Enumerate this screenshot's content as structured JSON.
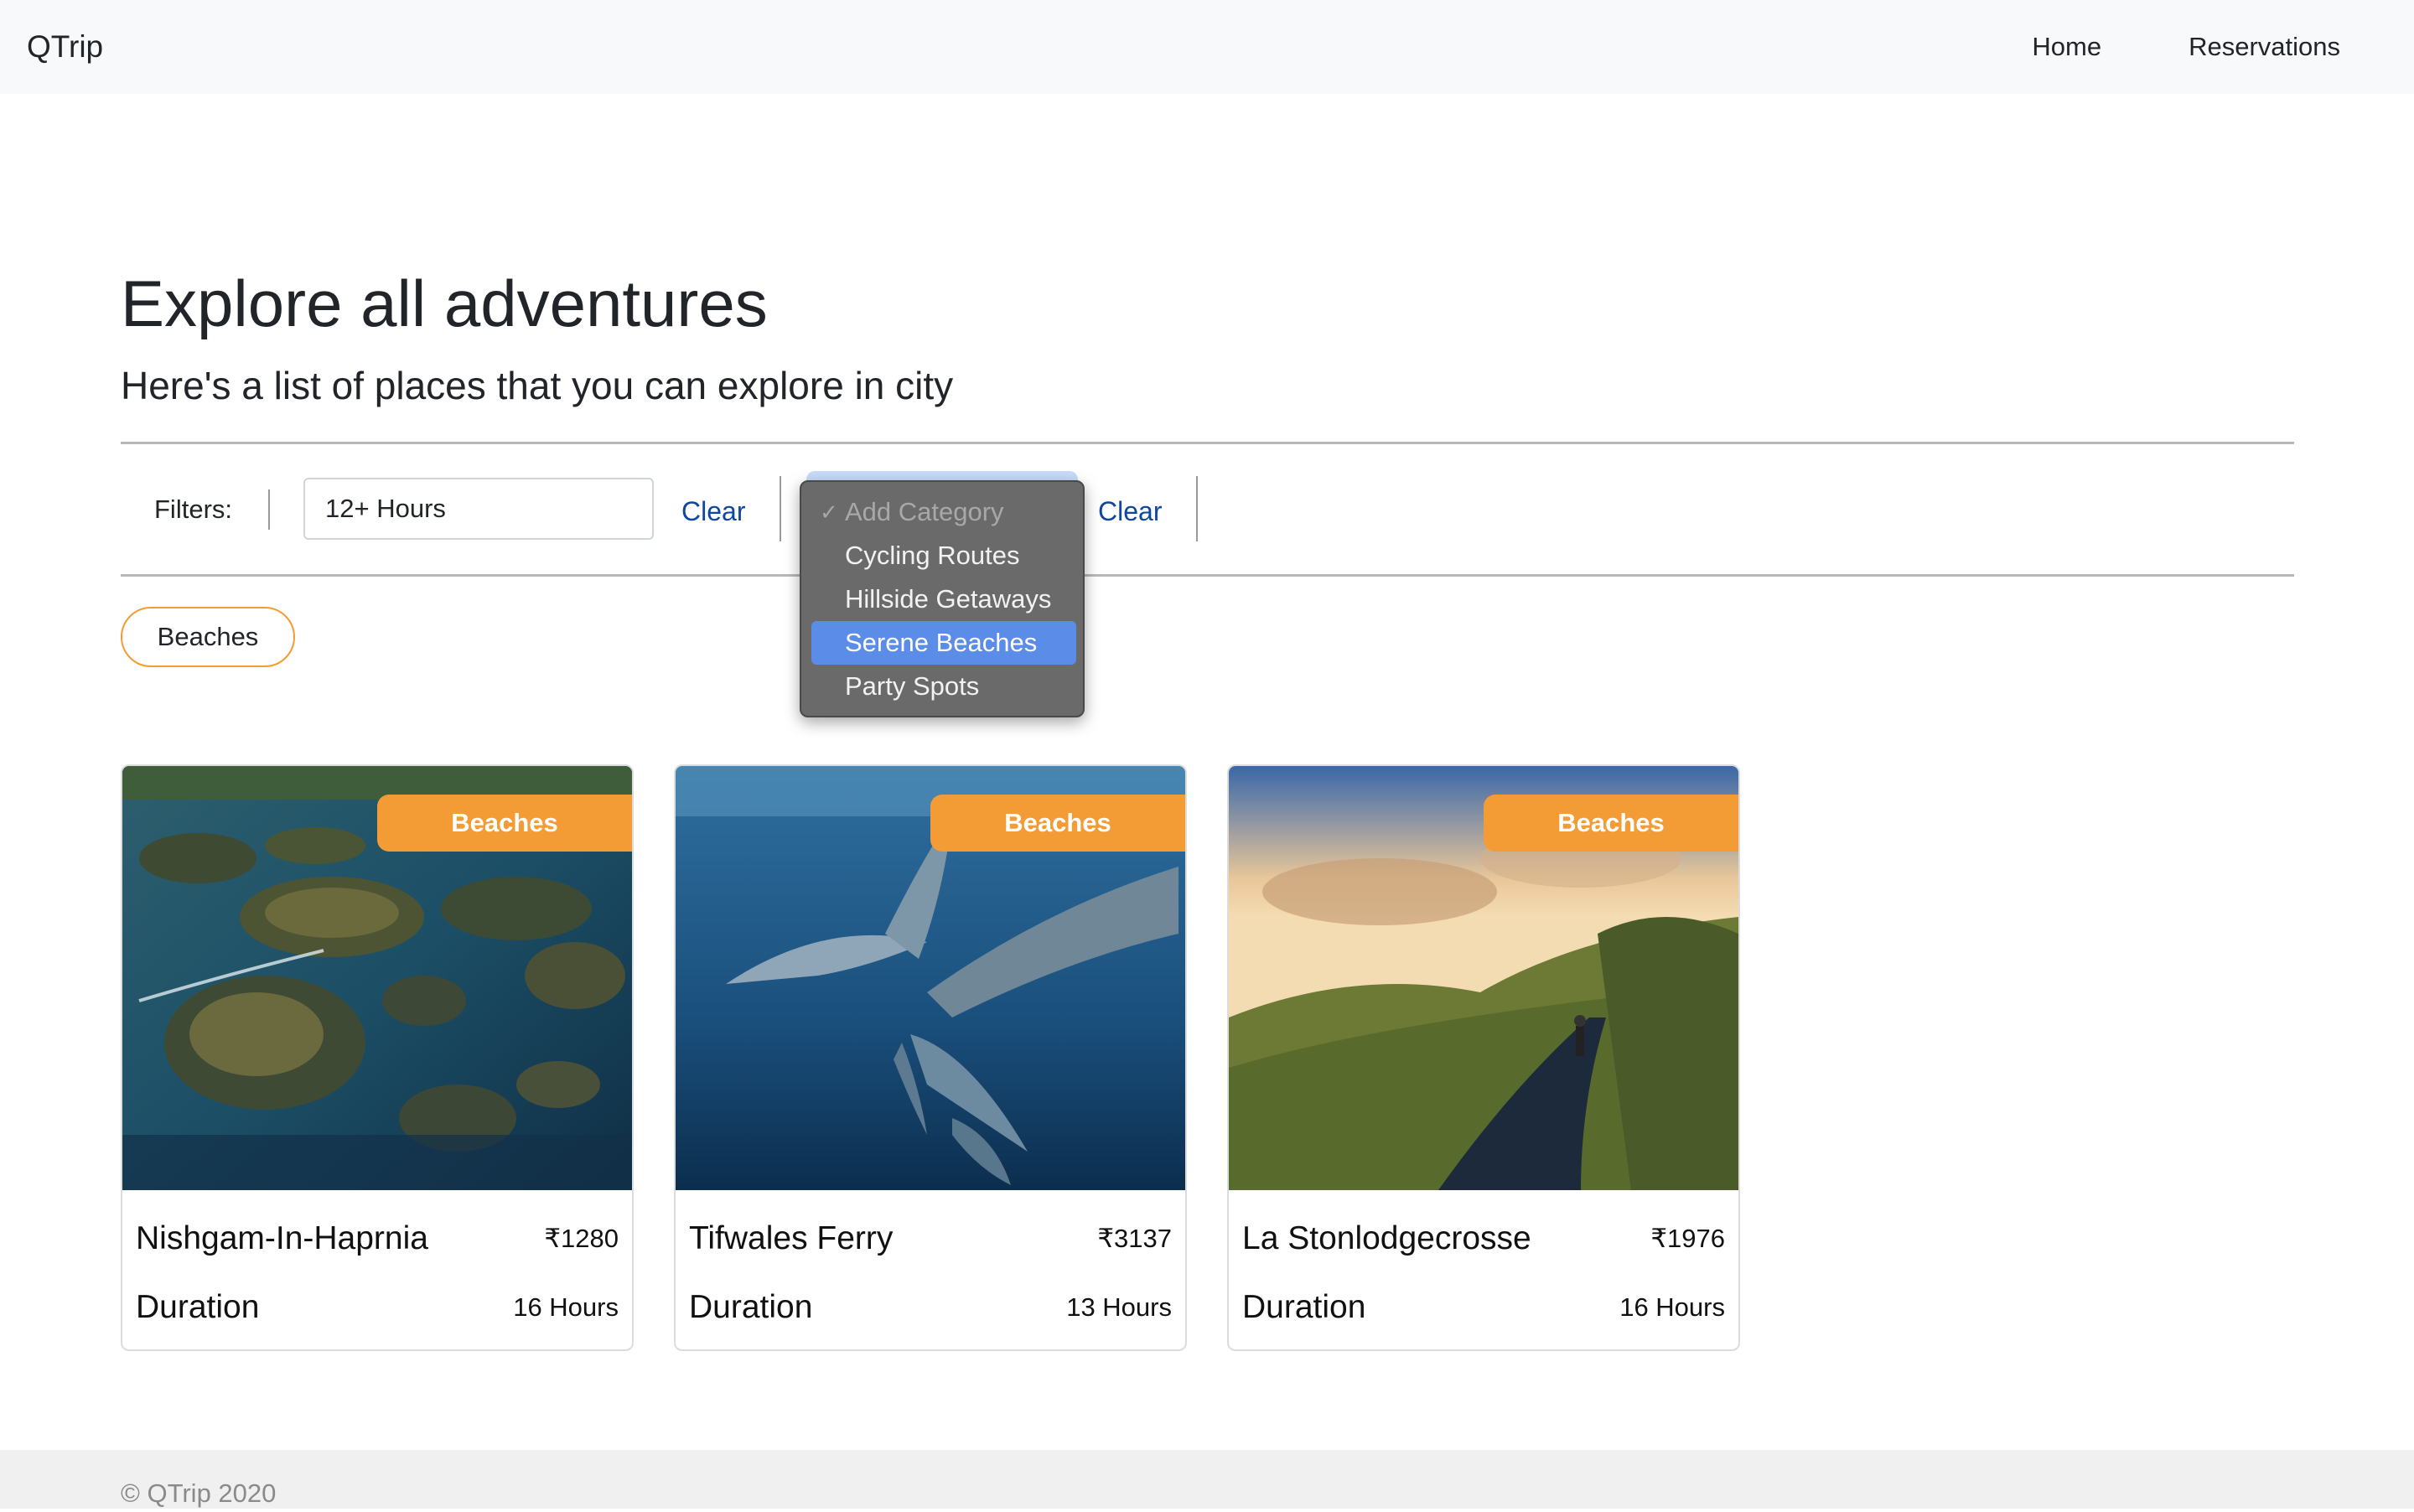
{
  "navbar": {
    "brand": "QTrip",
    "links": [
      "Home",
      "Reservations"
    ]
  },
  "header": {
    "title": "Explore all adventures",
    "subtitle": "Here's a list of places that you can explore in city"
  },
  "filters": {
    "label": "Filters:",
    "duration_value": "12+ Hours",
    "duration_clear": "Clear",
    "category_clear": "Clear",
    "category_dropdown": {
      "check_glyph": "✓",
      "options": [
        "Add Category",
        "Cycling Routes",
        "Hillside Getaways",
        "Serene Beaches",
        "Party Spots"
      ],
      "highlighted": "Serene Beaches"
    }
  },
  "active_filters": {
    "pills": [
      "Beaches"
    ]
  },
  "cards": [
    {
      "badge": "Beaches",
      "name": "Nishgam-In-Haprnia",
      "price": "₹1280",
      "duration_label": "Duration",
      "duration": "16 Hours",
      "image": "island-aerial"
    },
    {
      "badge": "Beaches",
      "name": "Tifwales Ferry",
      "price": "₹3137",
      "duration_label": "Duration",
      "duration": "13 Hours",
      "image": "dolphins-underwater"
    },
    {
      "badge": "Beaches",
      "name": "La Stonlodgecrosse",
      "price": "₹1976",
      "duration_label": "Duration",
      "duration": "16 Hours",
      "image": "cyclist-mountain-road"
    }
  ],
  "footer": {
    "copyright": "© QTrip 2020"
  },
  "colors": {
    "accent": "#f39c35",
    "link": "#0d47a1",
    "dropdown_highlight": "#5b8ce8"
  }
}
